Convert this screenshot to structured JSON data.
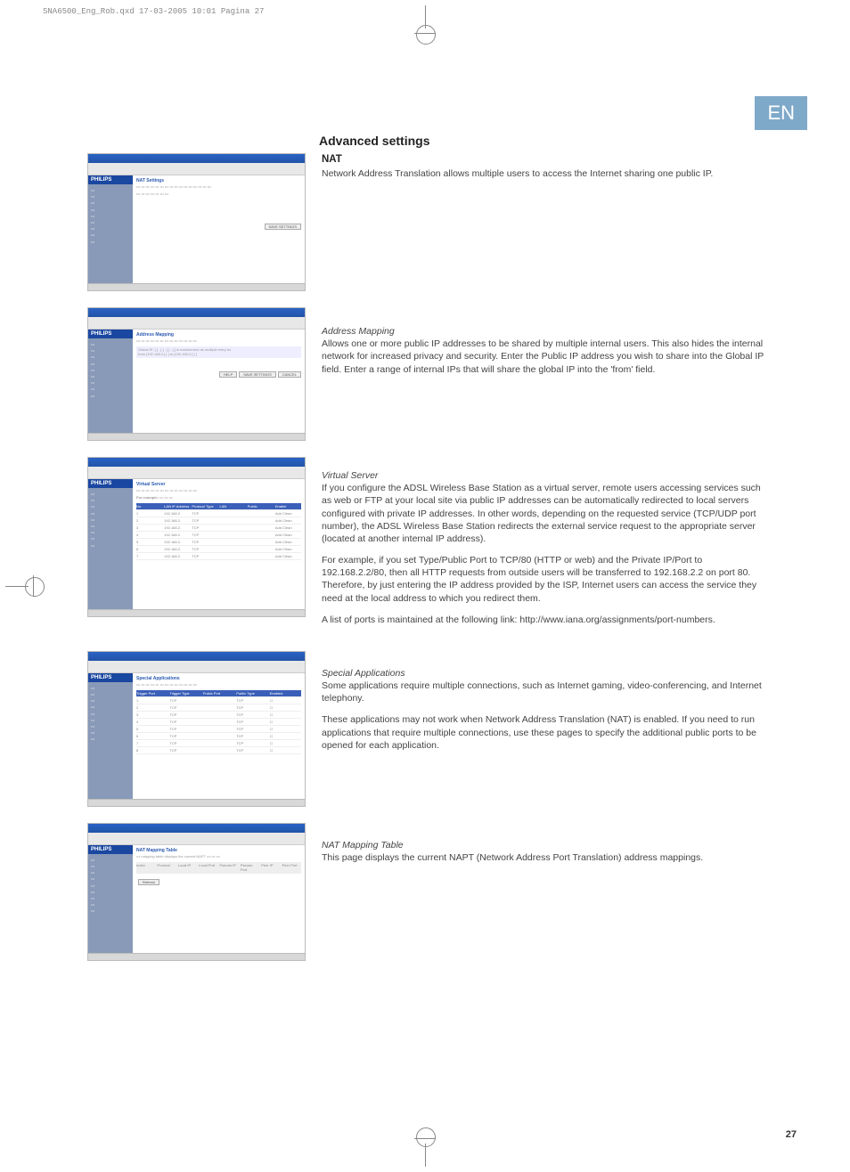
{
  "header_line": "SNA6500_Eng_Rob.qxd  17-03-2005  10:01  Pagina 27",
  "lang_badge": "EN",
  "page_number": "27",
  "main_title": "Advanced settings",
  "nat": {
    "heading": "NAT",
    "body": "Network Address Translation allows multiple users to access the Internet sharing one public IP."
  },
  "address_mapping": {
    "heading": "Address Mapping",
    "body": "Allows one or more public IP addresses to be shared by multiple internal users. This also hides the internal network for increased privacy and security. Enter the Public IP address you wish to share into the Global IP field. Enter a range of internal IPs that will share the global IP into the 'from' field."
  },
  "virtual_server": {
    "heading": "Virtual Server",
    "p1": "If you configure the ADSL Wireless Base Station as a virtual server, remote users accessing services such as web or FTP at your local site via public IP addresses can be automatically redirected to local servers configured with private IP addresses. In other words, depending on the requested service (TCP/UDP port number), the ADSL Wireless Base Station redirects the external service request to the appropriate server (located at another internal IP address).",
    "p2": "For example, if you set Type/Public Port to TCP/80 (HTTP or web) and the Private IP/Port to 192.168.2.2/80, then all HTTP requests from outside users will be transferred to 192.168.2.2 on port 80. Therefore, by just entering the IP address provided by the ISP, Internet users can access the service they need at the local address to which you redirect them.",
    "p3": "A list of ports is maintained at the following link: http://www.iana.org/assignments/port-numbers."
  },
  "special_apps": {
    "heading": "Special Applications",
    "p1": "Some applications require multiple connections, such as Internet gaming, video-conferencing, and Internet telephony.",
    "p2": "These applications may not work when Network Address Translation (NAT) is enabled. If you need to run applications that require multiple connections, use these pages to specify the additional public ports to be opened for each application."
  },
  "nat_mapping": {
    "heading": "NAT Mapping Table",
    "body": "This page displays the current NAPT (Network Address Port Translation) address mappings."
  },
  "ss": {
    "brand": "PHILIPS",
    "nat_settings_title": "NAT Settings",
    "save_settings_btn": "SAVE SETTINGS",
    "help_btn": "HELP",
    "cancel_btn": "CANCEL",
    "am_title": "Address Mapping",
    "vs_title": "Virtual Server",
    "sa_title": "Special Applications",
    "mt_title": "NAT Mapping Table",
    "refresh_btn": "Refresh",
    "sidebar_items": [
      "SETUP WIZARD",
      "SYSTEM",
      "WAN",
      "LAN",
      "WIRELESS",
      "NAT",
      "  Address Mapping",
      "  Virtual Server",
      "  Special Application",
      "  NAT Mapping Table",
      "ROUTING",
      "FIREWALL",
      "SNMP",
      "UPnP",
      "ADSL",
      "DDNS",
      "TOOLS",
      "STATUS"
    ]
  }
}
